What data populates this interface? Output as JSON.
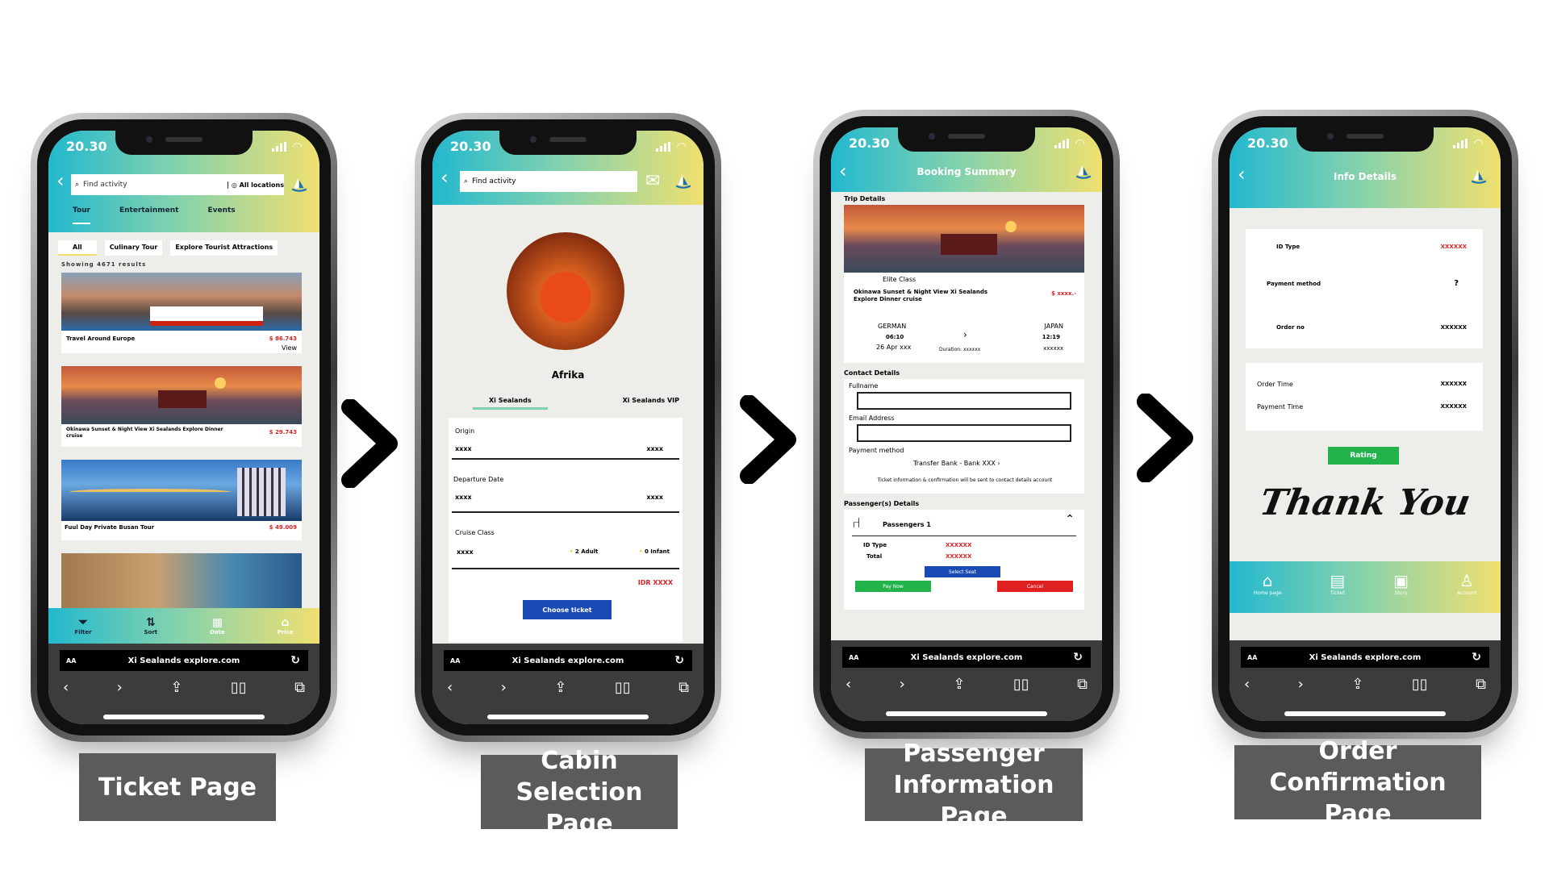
{
  "status_time": "20.30",
  "url": "Xi Sealands explore.com",
  "url_aa": "AA",
  "phone1": {
    "search_placeholder": "Find activity",
    "location": "All locations",
    "tabs": [
      "Tour",
      "Entertainment",
      "Events"
    ],
    "chips": [
      "All",
      "Culinary Tour",
      "Explore Tourist Attractions"
    ],
    "results": "Showing 4671 results",
    "cards": [
      {
        "title": "Travel Around Europe",
        "price": "$ 86.743",
        "action": "View"
      },
      {
        "title": "Okinawa Sunset & Night View Xi Sealands Explore Dinner cruise",
        "price": "$ 29.743"
      },
      {
        "title": "Fuul Day Private Busan Tour",
        "price": "$ 49.009"
      }
    ],
    "bottom_nav": [
      "Filter",
      "Sort",
      "Date",
      "Price"
    ]
  },
  "phone2": {
    "search_placeholder": "Find activity",
    "destination": "Afrika",
    "tabs": [
      "Xi Sealands",
      "Xi Sealands VIP"
    ],
    "origin_label": "Origin",
    "origin_value": "xxxx",
    "origin_right": "xxxx",
    "departure_label": "Departure Date",
    "departure_value": "xxxx",
    "departure_right": "xxxx",
    "class_label": "Cruise Class",
    "class_value": "xxxx",
    "adult": "2 Adult",
    "infant": "0 Infant",
    "price": "IDR XXXX",
    "button": "Choose ticket"
  },
  "phone3": {
    "title": "Booking Summary",
    "trip_label": "Trip Details",
    "class": "Elite Class",
    "trip_name": "Okinawa Sunset & Night View Xi Sealands Explore Dinner cruise",
    "trip_price": "$ xxxx.-",
    "from_country": "GERMAN",
    "from_time": "06:10",
    "from_date": "26 Apr xxx",
    "to_country": "JAPAN",
    "to_time": "12:19",
    "to_date": "xxxxxx",
    "duration": "Duration: xxxxxx",
    "contact_label": "Contact Details",
    "fullname": "Fullname",
    "email": "Email Address",
    "payment_label": "Payment method",
    "payment_value": "Transfer Bank - Bank XXX",
    "note": "Ticket information & confirmation will be sent to contact details account",
    "passenger_section": "Passenger(s) Details",
    "passenger": "Passengers 1",
    "id_type": "ID Type",
    "id_value": "XXXXXX",
    "total": "Total",
    "total_value": "XXXXXX",
    "select_seat": "Select Seat",
    "pay_now": "Pay Now",
    "cancel": "Cancel"
  },
  "phone4": {
    "title": "Info Details",
    "id_type": "ID Type",
    "id_value": "XXXXXX",
    "payment_method": "Payment method",
    "payment_value": "?",
    "order_no": "Order no",
    "order_value": "XXXXXX",
    "order_time": "Order Time",
    "order_time_value": "XXXXXX",
    "payment_time": "Payment Time",
    "payment_time_value": "XXXXXX",
    "rating": "Rating",
    "thanks": "Thank You",
    "nav": [
      "Home page",
      "Ticket",
      "Story",
      "Account"
    ]
  },
  "captions": [
    "Ticket Page",
    "Cabin Selection Page",
    "Passenger Information Page",
    "Order Confirmation Page"
  ],
  "colors": {
    "grad_start": "#22b8cf",
    "grad_end": "#f0e070",
    "button_blue": "#1a4bb5",
    "green": "#22b34a",
    "red": "#e02020"
  }
}
